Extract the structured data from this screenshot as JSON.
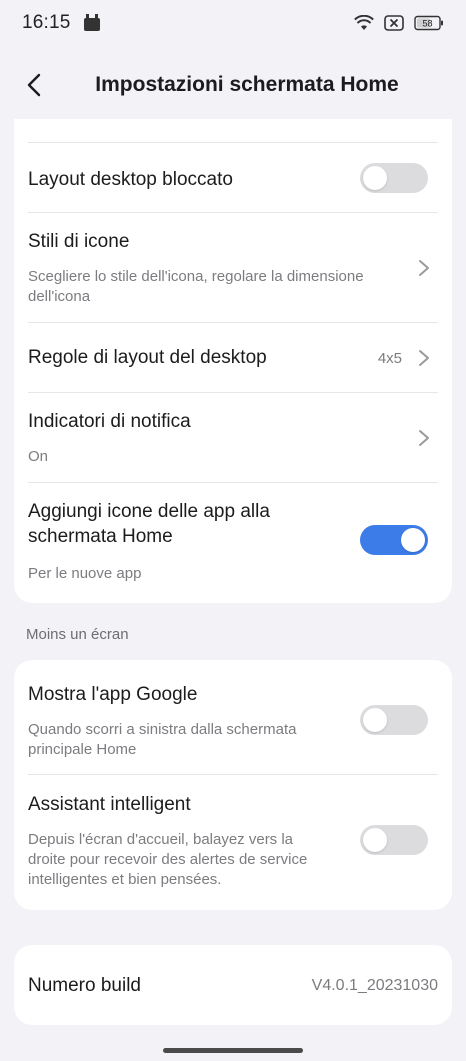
{
  "status_bar": {
    "time": "16:15",
    "battery_text": "58",
    "icons": [
      "app-notification-icon",
      "wifi-icon",
      "sim-disabled-icon",
      "battery-icon"
    ]
  },
  "header": {
    "title": "Impostazioni schermata Home",
    "back_icon": "back-arrow-icon"
  },
  "settings": {
    "layout_locked": {
      "title": "Layout desktop bloccato",
      "enabled": false
    },
    "icon_styles": {
      "title": "Stili di icone",
      "subtitle_line1": "Scegliere lo stile dell'icona, regolare la dimensione",
      "subtitle_line2": "dell'icona"
    },
    "layout_rules": {
      "title": "Regole di layout del desktop",
      "value": "4x5"
    },
    "notification_badges": {
      "title": "Indicatori di notifica",
      "value": "On"
    },
    "add_icons": {
      "title_line1": "Aggiungi icone delle app alla",
      "title_line2": "schermata Home",
      "subtitle": "Per le nuove app",
      "enabled": true
    }
  },
  "minus_screen": {
    "section_label": "Moins un écran",
    "show_google": {
      "title": "Mostra l'app Google",
      "subtitle_line1": "Quando scorri a sinistra dalla schermata",
      "subtitle_line2": "principale Home",
      "enabled": false
    },
    "smart_assistant": {
      "title": "Assistant intelligent",
      "subtitle_line1": "Depuis l'écran d'accueil, balayez vers la",
      "subtitle_line2": "droite pour recevoir des alertes de service",
      "subtitle_line3": "intelligentes et bien pensées.",
      "enabled": false
    }
  },
  "build": {
    "title": "Numero build",
    "value": "V4.0.1_20231030"
  },
  "colors": {
    "background": "#f2f2f7",
    "card": "#ffffff",
    "toggle_on": "#3b7ce8",
    "toggle_off": "#dcdcdf"
  }
}
